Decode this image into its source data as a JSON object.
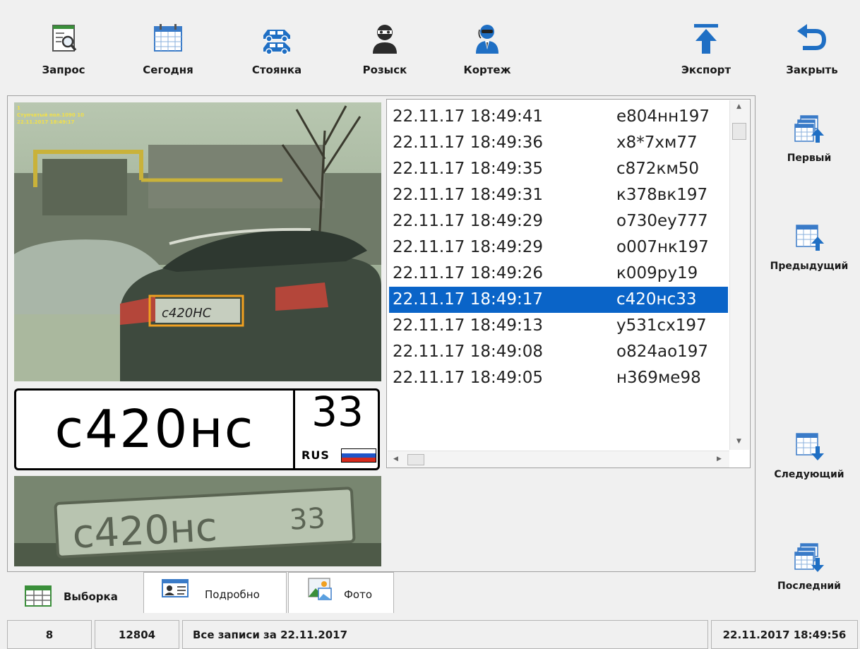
{
  "toolbar": {
    "query_label": "Запрос",
    "today_label": "Сегодня",
    "parking_label": "Стоянка",
    "wanted_label": "Розыск",
    "motorcade_label": "Кортеж",
    "export_label": "Экспорт",
    "close_label": "Закрыть"
  },
  "nav": {
    "first_label": "Первый",
    "prev_label": "Предыдущий",
    "next_label": "Следующий",
    "last_label": "Последний"
  },
  "camera": {
    "overlay_line1": "1",
    "overlay_line2": "Ступчатый пол.1090 10",
    "overlay_line3": "22.11.2017 18:49:17"
  },
  "plate": {
    "main": "с420нс",
    "region": "33",
    "country": "RUS",
    "crop_main": "с420нс",
    "crop_region": "33"
  },
  "list": {
    "selected_index": 7,
    "rows": [
      {
        "time": "22.11.17 18:49:41",
        "plate": "е804нн197"
      },
      {
        "time": "22.11.17 18:49:36",
        "plate": "х8*7хм77"
      },
      {
        "time": "22.11.17 18:49:35",
        "plate": "с872км50"
      },
      {
        "time": "22.11.17 18:49:31",
        "plate": "к378вк197"
      },
      {
        "time": "22.11.17 18:49:29",
        "plate": "о730еу777"
      },
      {
        "time": "22.11.17 18:49:29",
        "plate": "о007нк197"
      },
      {
        "time": "22.11.17 18:49:26",
        "plate": "к009ру19"
      },
      {
        "time": "22.11.17 18:49:17",
        "plate": "с420нс33"
      },
      {
        "time": "22.11.17 18:49:13",
        "plate": "у531сх197"
      },
      {
        "time": "22.11.17 18:49:08",
        "plate": "о824ао197"
      },
      {
        "time": "22.11.17 18:49:05",
        "plate": "н369ме98"
      }
    ]
  },
  "tabs": {
    "selection": "Выборка",
    "details": "Подробно",
    "photo": "Фото"
  },
  "status": {
    "count": "8",
    "total": "12804",
    "message": "Все записи за 22.11.2017",
    "datetime": "22.11.2017 18:49:56"
  },
  "colors": {
    "selection": "#0a64c8",
    "icon_blue": "#1f6fc4",
    "icon_dark": "#2b2b2b"
  }
}
